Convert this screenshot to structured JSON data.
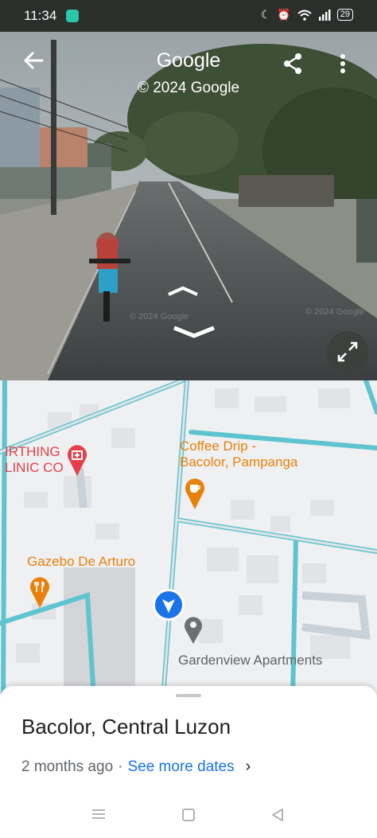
{
  "status_bar": {
    "time": "11:34",
    "battery": "29",
    "icons": [
      "message-app-icon",
      "moon-icon",
      "alarm-icon",
      "wifi-icon",
      "signal-icon",
      "battery-icon"
    ]
  },
  "street_view": {
    "title": "Google",
    "copyright": "© 2024 Google",
    "watermark": "© 2024 Google",
    "icons": [
      "back-arrow-icon",
      "share-icon",
      "more-vert-icon",
      "expand-icon",
      "nav-arrow-up-icon",
      "nav-arrow-down-icon"
    ]
  },
  "map": {
    "pois": [
      {
        "line1": "IRTHING",
        "line2": "LINIC CO",
        "icon": "hospital-icon",
        "color": "#e5404a"
      },
      {
        "line1": "Coffee Drip -",
        "line2": "Bacolor, Pampanga",
        "icon": "cafe-icon",
        "color": "#e8810c"
      },
      {
        "line1": "Gazebo De Arturo",
        "icon": "restaurant-icon",
        "color": "#e8810c"
      },
      {
        "line1": "Gardenview Apartments",
        "icon": "place-pin-icon",
        "color": "#5f6368"
      }
    ],
    "accent": "#1a73e8",
    "road_color": "#5ec4cf"
  },
  "sheet": {
    "place_name": "Bacolor, Central Luzon",
    "date": "2 months ago",
    "separator": "·",
    "link": "See more dates",
    "chevron": "›"
  },
  "system_nav": {
    "icons": [
      "menu-lines-icon",
      "home-square-icon",
      "back-triangle-icon"
    ]
  }
}
